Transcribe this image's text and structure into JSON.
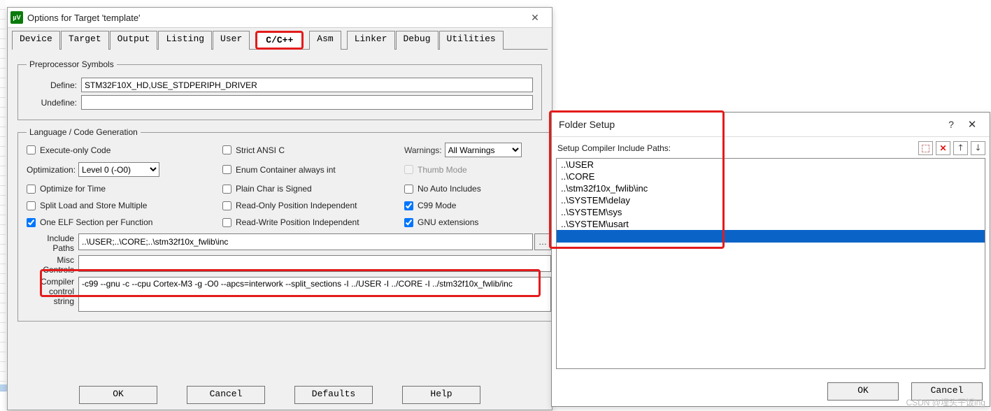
{
  "dialog1": {
    "title": "Options for Target 'template'",
    "tabs": [
      "Device",
      "Target",
      "Output",
      "Listing",
      "User",
      "C/C++",
      "Asm",
      "Linker",
      "Debug",
      "Utilities"
    ],
    "active_tab": "C/C++",
    "preproc": {
      "legend": "Preprocessor Symbols",
      "define_label": "Define:",
      "define_val": "STM32F10X_HD,USE_STDPERIPH_DRIVER",
      "undefine_label": "Undefine:",
      "undefine_val": ""
    },
    "lang": {
      "legend": "Language / Code Generation",
      "execute_only": "Execute-only Code",
      "strict_ansi": "Strict ANSI C",
      "warnings_label": "Warnings:",
      "warnings_val": "All Warnings",
      "opt_label": "Optimization:",
      "opt_val": "Level 0 (-O0)",
      "enum_cont": "Enum Container always int",
      "thumb": "Thumb Mode",
      "opt_time": "Optimize for Time",
      "plain_char": "Plain Char is Signed",
      "no_auto": "No Auto Includes",
      "split_load": "Split Load and Store Multiple",
      "ro_pos": "Read-Only Position Independent",
      "c99": "C99 Mode",
      "one_elf": "One ELF Section per Function",
      "rw_pos": "Read-Write Position Independent",
      "gnu_ext": "GNU extensions"
    },
    "include_paths_label": "Include\nPaths",
    "include_paths_val": "..\\USER;..\\CORE;..\\stm32f10x_fwlib\\inc",
    "misc_label": "Misc\nControls",
    "misc_val": "",
    "compiler_label": "Compiler\ncontrol\nstring",
    "compiler_val": "-c99 --gnu -c --cpu Cortex-M3 -g -O0 --apcs=interwork --split_sections -I ../USER -I ../CORE -I ../stm32f10x_fwlib/inc",
    "buttons": {
      "ok": "OK",
      "cancel": "Cancel",
      "defaults": "Defaults",
      "help": "Help"
    }
  },
  "dialog2": {
    "title": "Folder Setup",
    "head_label": "Setup Compiler Include Paths:",
    "items": [
      "..\\USER",
      "..\\CORE",
      "..\\stm32f10x_fwlib\\inc",
      "..\\SYSTEM\\delay",
      "..\\SYSTEM\\sys",
      "..\\SYSTEM\\usart"
    ],
    "buttons": {
      "ok": "OK",
      "cancel": "Cancel"
    },
    "help_icon": "?",
    "close_icon": "✕"
  },
  "watermark": "CSDN @埋头干饭ing"
}
